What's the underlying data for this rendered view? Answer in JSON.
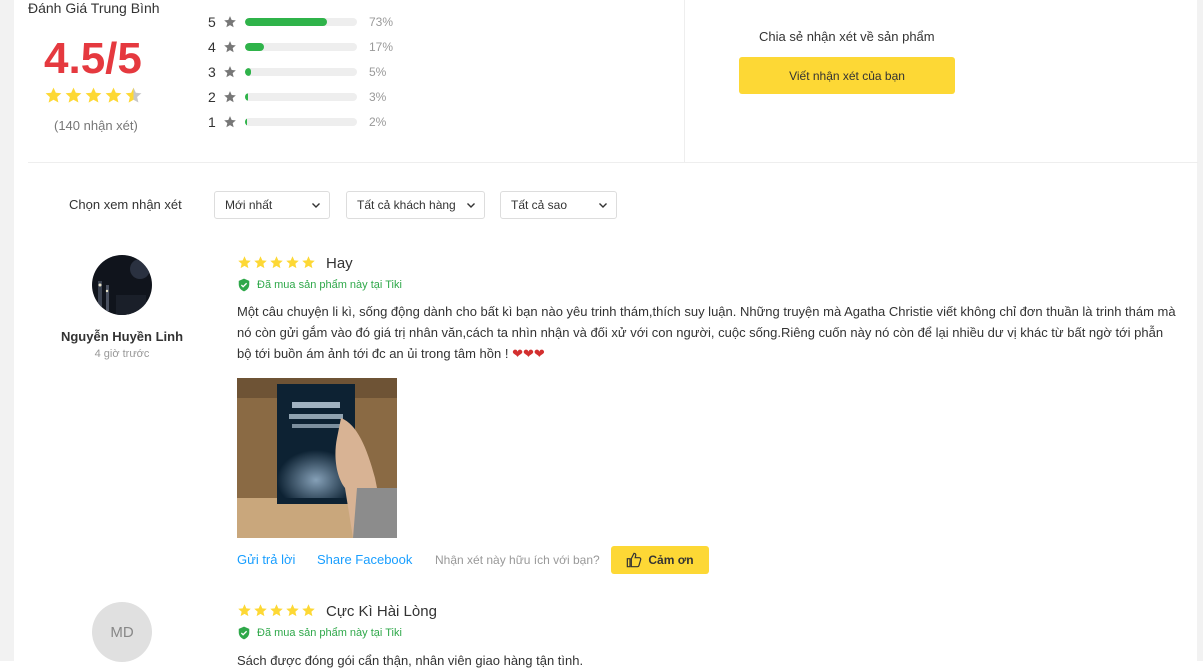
{
  "summary": {
    "title": "Đánh Giá Trung Bình",
    "score": "4.5/5",
    "rating_value": 4.5,
    "review_count": "(140 nhận xét)",
    "distribution": [
      {
        "stars": "5",
        "percent": "73%",
        "fraction": 0.73
      },
      {
        "stars": "4",
        "percent": "17%",
        "fraction": 0.17
      },
      {
        "stars": "3",
        "percent": "5%",
        "fraction": 0.05
      },
      {
        "stars": "2",
        "percent": "3%",
        "fraction": 0.03
      },
      {
        "stars": "1",
        "percent": "2%",
        "fraction": 0.02
      }
    ]
  },
  "share": {
    "prompt": "Chia sẻ nhận xét về sản phẩm",
    "button_label": "Viết nhận xét của bạn"
  },
  "filters": {
    "label": "Chọn xem nhận xét",
    "sort": "Mới nhất",
    "customers": "Tất cả khách hàng",
    "stars": "Tất cả sao"
  },
  "reviews": [
    {
      "name": "Nguyễn Huyền Linh",
      "time": "4 giờ trước",
      "rating": 5,
      "title": "Hay",
      "verified": "Đã mua sản phẩm này tại Tiki",
      "body": "Một câu chuyện li kì, sống động dành cho bất kì bạn nào yêu trinh thám,thích suy luận. Những truyện mà Agatha Christie viết không chỉ đơn thuần là trinh thám mà nó còn gửi gắm vào đó giá trị nhân văn,cách ta nhìn nhận và đối xử với con người, cuộc sống.Riêng cuốn này nó còn để lại nhiều dư vị khác từ bất ngờ tới phẫn bộ tới buồn ám ảnh tới đc an ủi trong tâm hồn !",
      "hearts": "❤❤❤",
      "reply": "Gửi trả lời",
      "share": "Share Facebook",
      "helpful": "Nhận xét này hữu ích với bạn?",
      "thanks": "Cảm ơn"
    },
    {
      "initials": "MD",
      "rating": 5,
      "title": "Cực Kì Hài Lòng",
      "verified": "Đã mua sản phẩm này tại Tiki",
      "body": "Sách được đóng gói cẩn thận, nhân viên giao hàng tận tình."
    }
  ],
  "colors": {
    "accent_red": "#e5393f",
    "star_yellow": "#fdd835",
    "bar_green": "#2fb34a",
    "link_blue": "#189eff"
  }
}
